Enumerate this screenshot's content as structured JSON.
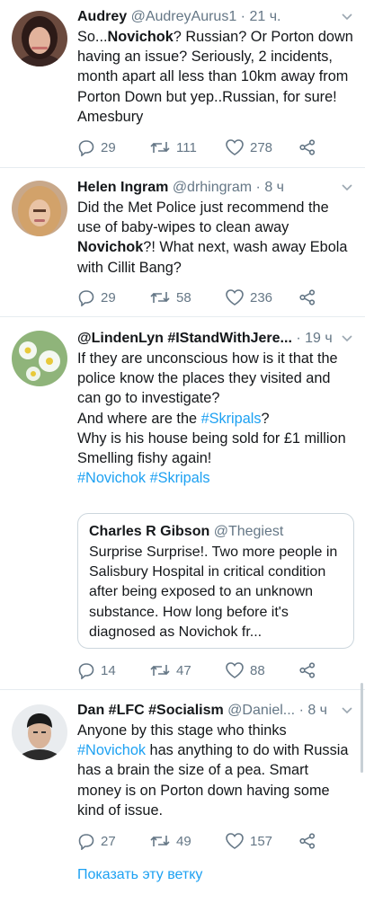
{
  "tweets": [
    {
      "name": "Audrey",
      "handle": "@AudreyAurus1",
      "time": "· 21 ч.",
      "text_parts": [
        {
          "t": "So...",
          "s": "plain"
        },
        {
          "t": "Novichok",
          "s": "bold"
        },
        {
          "t": "? Russian? Or Porton down having an issue? Seriously, 2 incidents, month apart all less than 10km away from Porton Down but yep..Russian, for sure! Amesbury",
          "s": "plain"
        }
      ],
      "replies": "29",
      "retweets": "111",
      "likes": "278"
    },
    {
      "name": "Helen Ingram",
      "handle": "@drhingram",
      "time": "· 8 ч",
      "text_parts": [
        {
          "t": "Did the Met Police just recommend the use of baby-wipes to clean away ",
          "s": "plain"
        },
        {
          "t": "Novichok",
          "s": "bold"
        },
        {
          "t": "?! What next, wash away Ebola with Cillit Bang?",
          "s": "plain"
        }
      ],
      "replies": "29",
      "retweets": "58",
      "likes": "236"
    },
    {
      "name": "@LindenLyn #IStandWithJere...",
      "handle": "",
      "time": "· 19 ч",
      "text_parts": [
        {
          "t": "If they are unconscious how is it that the police know the places they visited and can go to investigate?\nAnd where are the ",
          "s": "plain"
        },
        {
          "t": "#Skripals",
          "s": "tag"
        },
        {
          "t": "?\nWhy is his house being sold for £1 million\nSmelling fishy again!\n",
          "s": "plain"
        },
        {
          "t": "#Novichok",
          "s": "tag"
        },
        {
          "t": " ",
          "s": "plain"
        },
        {
          "t": "#Skripals",
          "s": "tag"
        }
      ],
      "quote": {
        "name": "Charles R Gibson",
        "handle": "@Thegiest",
        "text": "Surprise Surprise!. Two more people in Salisbury Hospital in critical condition after being exposed to an unknown substance. How long before it's diagnosed as Novichok fr..."
      },
      "replies": "14",
      "retweets": "47",
      "likes": "88"
    },
    {
      "name": "Dan #LFC #Socialism",
      "handle": "@Daniel...",
      "time": "· 8 ч",
      "text_parts": [
        {
          "t": "Anyone by this stage who thinks ",
          "s": "plain"
        },
        {
          "t": "#Novichok",
          "s": "tag"
        },
        {
          "t": " has anything to do with Russia has a brain the size of a pea. Smart money is on Porton down having some kind of issue.",
          "s": "plain"
        }
      ],
      "replies": "27",
      "retweets": "49",
      "likes": "157"
    }
  ],
  "show_thread": "Показать эту ветку",
  "colors": {
    "accent": "#1da1f2",
    "secondary": "#657786",
    "border": "#e6ecf0"
  }
}
